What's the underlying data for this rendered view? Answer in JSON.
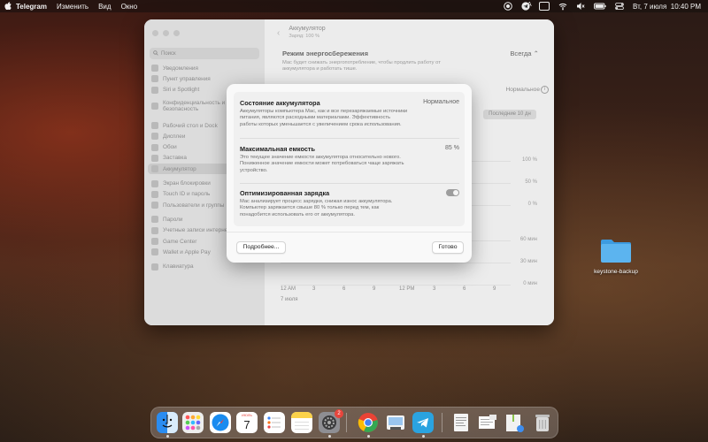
{
  "menubar": {
    "app_name": "Telegram",
    "items": [
      "Изменить",
      "Вид",
      "Окно"
    ],
    "input_source": "A",
    "datetime": "Вт, 7 июля  10:40 PM",
    "icons": [
      "apple-icon",
      "screen-record-icon",
      "telegram-status-icon",
      "input-source-icon",
      "wifi-icon",
      "volume-muted-icon",
      "battery-icon",
      "control-center-icon"
    ]
  },
  "window": {
    "sidebar": {
      "search_placeholder": "Поиск",
      "items": [
        "Уведомления",
        "Пункт управления",
        "Siri и Spotlight",
        "Конфиденциальность и безопасность",
        "Рабочий стол и Dock",
        "Дисплеи",
        "Обои",
        "Заставка",
        "Аккумулятор",
        "Экран блокировки",
        "Touch ID и пароль",
        "Пользователи и группы",
        "Пароли",
        "Учетные записи интернета",
        "Game Center",
        "Wallet и Apple Pay",
        "Клавиатура"
      ],
      "active_index": 8
    },
    "header": {
      "title": "Аккумулятор",
      "subtitle": "Заряд: 100 %"
    },
    "mode": {
      "label": "Режим энергосбережения",
      "value": "Всегда",
      "description": "Mac будет снижать энергопотребление, чтобы продлить работу от аккумулятора и работать тише."
    },
    "charge_label": "Нормальное",
    "tab_label": "Последние 10 дн",
    "y_axis": [
      "100 %",
      "50 %",
      "0 %",
      "60 мин",
      "30 мин",
      "0 мин"
    ],
    "x_axis": [
      "12 AM",
      "3",
      "6",
      "9",
      "12 PM",
      "3",
      "6",
      "9"
    ],
    "date": "7 июля"
  },
  "modal": {
    "sections": [
      {
        "title": "Состояние аккумулятора",
        "value": "Нормальное",
        "description": "Аккумуляторы компьютера Mac, как и все перезаряжаемые источники питания, являются расходными материалами. Эффективность работы которых уменьшается с увеличением срока использования."
      },
      {
        "title": "Максимальная емкость",
        "value": "85 %",
        "description": "Это текущее значение емкости аккумулятора относительно нового. Пониженное значение емкости может потребоваться чаще заряжать устройство."
      },
      {
        "title": "Оптимизированная зарядка",
        "toggle_on": true,
        "description": "Mac анализирует процесс зарядки, снижая износ аккумулятора. Компьютер заряжается свыше 80 % только перед тем, как понадобится использовать его от аккумулятора."
      }
    ],
    "more_button": "Подробнее...",
    "done_button": "Готово"
  },
  "desktop": {
    "folder_label": "keystone-backup"
  },
  "dock": {
    "apps": [
      {
        "name": "finder-icon",
        "running": true
      },
      {
        "name": "launchpad-icon",
        "running": false
      },
      {
        "name": "safari-icon",
        "running": false
      },
      {
        "name": "calendar-icon",
        "running": false,
        "month": "ИЮЛЬ",
        "day": "7"
      },
      {
        "name": "reminders-icon",
        "running": false
      },
      {
        "name": "notes-icon",
        "running": false
      },
      {
        "name": "system-settings-icon",
        "running": true,
        "badge": "2"
      },
      {
        "name": "chrome-icon",
        "running": true
      },
      {
        "name": "preview-icon",
        "running": false
      },
      {
        "name": "telegram-icon",
        "running": true
      },
      {
        "name": "document-icon",
        "running": false
      },
      {
        "name": "downloads-stack-icon",
        "running": false
      },
      {
        "name": "archive-icon",
        "running": false
      },
      {
        "name": "trash-icon",
        "running": false
      }
    ]
  }
}
